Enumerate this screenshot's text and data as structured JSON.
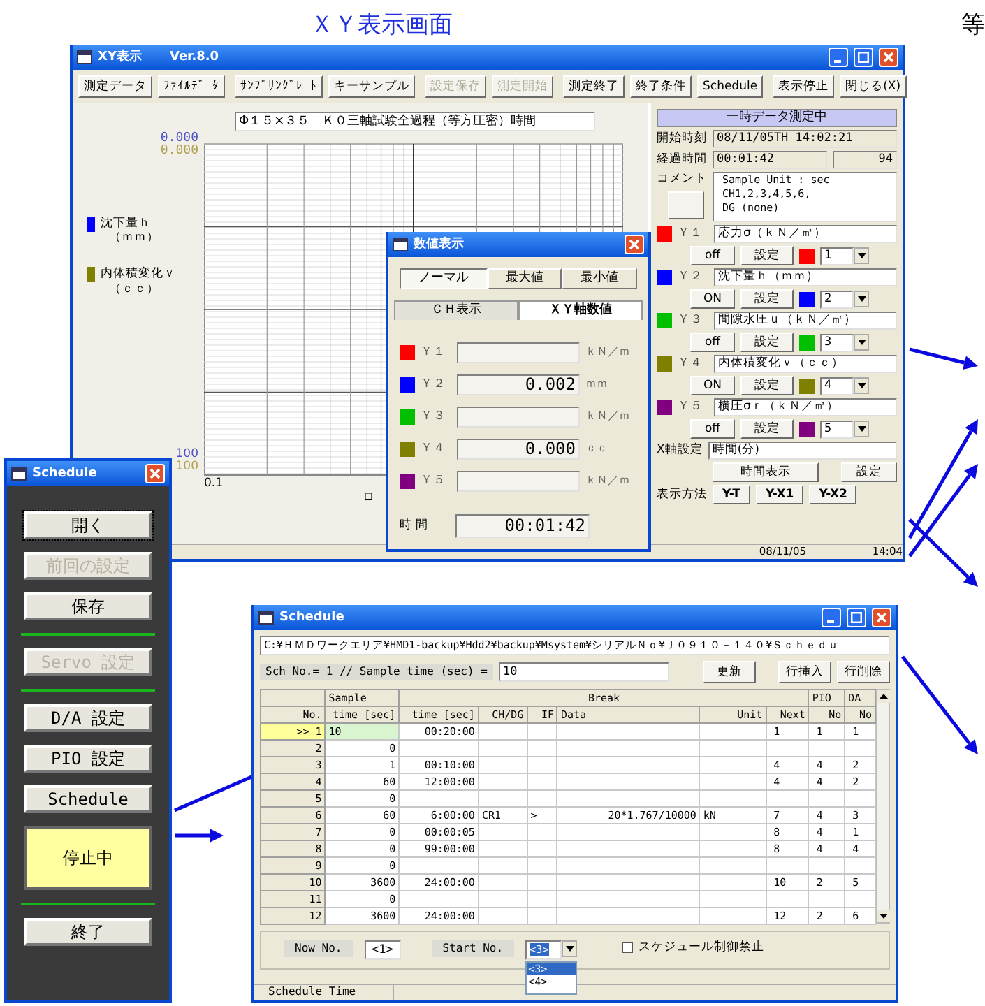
{
  "caption": "ＸＹ表示画面",
  "corner_text": "等",
  "xy_window": {
    "title": "XY表示",
    "version": "Ver.8.0",
    "toolbar": [
      {
        "label": "測定データ",
        "disabled": false
      },
      {
        "label": "ﾌｧｲﾙﾃﾞｰﾀ",
        "disabled": false
      },
      {
        "label": "ｻﾝﾌﾟﾘﾝｸﾞﾚｰﾄ",
        "disabled": false
      },
      {
        "label": "キーサンプル",
        "disabled": false
      },
      {
        "label": "設定保存",
        "disabled": true
      },
      {
        "label": "測定開始",
        "disabled": true
      },
      {
        "label": "測定終了",
        "disabled": false
      },
      {
        "label": "終了条件",
        "disabled": false
      },
      {
        "label": "Schedule",
        "disabled": false
      },
      {
        "label": "表示停止",
        "disabled": false
      },
      {
        "label": "閉じる(X)",
        "disabled": false
      }
    ],
    "chart": {
      "title": "Φ１５×３５　Ｋ０三軸試験全過程（等方圧密）時間",
      "y_top": [
        {
          "text": "0.000",
          "color": "#5050c8"
        },
        {
          "text": "0.000",
          "color": "#b0a050"
        }
      ],
      "y_bottom": [
        {
          "text": "100",
          "color": "#5050c8"
        },
        {
          "text": "100",
          "color": "#b0a050"
        }
      ],
      "x_start": "0.1",
      "x_mark": "ロ",
      "legend": [
        {
          "label": "沈下量ｈ",
          "unit": "（ｍｍ）",
          "color": "#0000ff"
        },
        {
          "label": "内体積変化ｖ",
          "unit": "（ｃｃ）",
          "color": "#808000"
        }
      ]
    },
    "panel": {
      "status": "一時データ測定中",
      "start_label": "開始時刻",
      "start_value": "08/11/05TH 14:02:21",
      "elapsed_label": "経過時間",
      "elapsed_value": "00:01:42",
      "count": "94",
      "comment_label": "コメント",
      "comment_lines": [
        "Sample Unit : sec",
        "CH1,2,3,4,5,6,",
        "DG (none)"
      ],
      "channels": [
        {
          "label": "Ｙ１",
          "name": "応力σ（ｋＮ／㎡）",
          "toggle": "off",
          "set": "設定",
          "color": "#ff0000",
          "number": "1"
        },
        {
          "label": "Ｙ２",
          "name": "沈下量ｈ（ｍｍ）",
          "toggle": "ON",
          "set": "設定",
          "color": "#0000ff",
          "number": "2"
        },
        {
          "label": "Ｙ３",
          "name": "間隙水圧ｕ（ｋＮ／㎡）",
          "toggle": "off",
          "set": "設定",
          "color": "#00c000",
          "number": "3"
        },
        {
          "label": "Ｙ４",
          "name": "内体積変化ｖ（ｃｃ）",
          "toggle": "ON",
          "set": "設定",
          "color": "#808000",
          "number": "4"
        },
        {
          "label": "Ｙ５",
          "name": "横圧σｒ（ｋＮ／㎡）",
          "toggle": "off",
          "set": "設定",
          "color": "#800080",
          "number": "5"
        }
      ],
      "x_axis_label": "X軸設定",
      "x_axis_value": "時間(分)",
      "time_button": "時間表示",
      "set_button": "設定",
      "mode_label": "表示方法",
      "modes": [
        "Y-T",
        "Y-X1",
        "Y-X2"
      ]
    },
    "status_bar": [
      "08/11/05",
      "14:04"
    ]
  },
  "value_window": {
    "title": "数値表示",
    "tabs": [
      {
        "label": "ノーマル",
        "selected": true
      },
      {
        "label": "最大値",
        "selected": false
      },
      {
        "label": "最小値",
        "selected": false
      }
    ],
    "view_tabs": [
      {
        "label": "ＣＨ表示",
        "selected": false
      },
      {
        "label": "ＸＹ軸数値",
        "selected": true
      }
    ],
    "rows": [
      {
        "label": "Ｙ１",
        "color": "#ff0000",
        "unit": "ｋＮ／ｍ"
      },
      {
        "label": "Ｙ２",
        "color": "#0000ff",
        "value": "0.002",
        "unit": "ｍｍ"
      },
      {
        "label": "Ｙ３",
        "color": "#00c000",
        "unit": "ｋＮ／ｍ"
      },
      {
        "label": "Ｙ４",
        "color": "#808000",
        "value": "0.000",
        "unit": "ｃｃ"
      },
      {
        "label": "Ｙ５",
        "color": "#800080",
        "unit": "ｋＮ／ｍ"
      }
    ],
    "time_label": "時 間",
    "time_value": "00:01:42"
  },
  "schedule_panel": {
    "title": "Schedule",
    "items": [
      {
        "kind": "button",
        "label": "開く",
        "disabled": false
      },
      {
        "kind": "button",
        "label": "前回の設定",
        "disabled": true
      },
      {
        "kind": "button",
        "label": "保存",
        "disabled": false
      },
      {
        "kind": "divider"
      },
      {
        "kind": "button",
        "label": "Servo 設定",
        "disabled": true
      },
      {
        "kind": "divider"
      },
      {
        "kind": "button",
        "label": "D/A 設定",
        "disabled": false
      },
      {
        "kind": "button",
        "label": "PIO 設定",
        "disabled": false
      },
      {
        "kind": "button",
        "label": "Schedule",
        "disabled": false
      },
      {
        "kind": "status",
        "label": "停止中"
      },
      {
        "kind": "divider"
      },
      {
        "kind": "button",
        "label": "終了",
        "disabled": false
      }
    ]
  },
  "schedule_window": {
    "title": "Schedule",
    "path": "C:¥ＨＭＤワークエリア¥HMD1-backup¥Hdd2¥backup¥Msystem¥シリアルＮｏ¥Ｊ０９１０－１４０¥Ｓｃｈｅｄｕ",
    "sch_label": "Sch No.= 1 // Sample time (sec) =",
    "sch_value": "10",
    "buttons": [
      "更新",
      "行挿入",
      "行削除"
    ],
    "row_header": "No.",
    "column_groups": [
      {
        "label": "Sample",
        "columns": [
          "time [sec]"
        ]
      },
      {
        "label": "Break",
        "columns": [
          "time [sec]",
          "CH/DG",
          "IF",
          "Data",
          "Unit",
          "Next"
        ]
      },
      {
        "label": "PIO",
        "columns": [
          "No"
        ]
      },
      {
        "label": "DA",
        "columns": [
          "No"
        ]
      }
    ],
    "rows": [
      {
        "no": ">> 1",
        "selected": true,
        "cells": [
          "10",
          "00:20:00",
          null,
          null,
          null,
          null,
          "1",
          "1",
          "1"
        ]
      },
      {
        "no": "2",
        "selected": false,
        "cells": [
          "0",
          null,
          null,
          null,
          null,
          null,
          null,
          null,
          null
        ]
      },
      {
        "no": "3",
        "selected": false,
        "cells": [
          "1",
          "00:10:00",
          null,
          null,
          null,
          null,
          "4",
          "4",
          "2"
        ]
      },
      {
        "no": "4",
        "selected": false,
        "cells": [
          "60",
          "12:00:00",
          null,
          null,
          null,
          null,
          "4",
          "4",
          "2"
        ]
      },
      {
        "no": "5",
        "selected": false,
        "cells": [
          "0",
          null,
          null,
          null,
          null,
          null,
          null,
          null,
          null
        ]
      },
      {
        "no": "6",
        "selected": false,
        "cells": [
          "60",
          "6:00:00",
          "CR1",
          ">",
          "20*1.767/10000",
          "kN",
          "7",
          "4",
          "3"
        ]
      },
      {
        "no": "7",
        "selected": false,
        "cells": [
          "0",
          "00:00:05",
          null,
          null,
          null,
          null,
          "8",
          "4",
          "1"
        ]
      },
      {
        "no": "8",
        "selected": false,
        "cells": [
          "0",
          "99:00:00",
          null,
          null,
          null,
          null,
          "8",
          "4",
          "4"
        ]
      },
      {
        "no": "9",
        "selected": false,
        "cells": [
          "0",
          null,
          null,
          null,
          null,
          null,
          null,
          null,
          null
        ]
      },
      {
        "no": "10",
        "selected": false,
        "cells": [
          "3600",
          "24:00:00",
          null,
          null,
          null,
          null,
          "10",
          "2",
          "5"
        ]
      },
      {
        "no": "11",
        "selected": false,
        "cells": [
          "0",
          null,
          null,
          null,
          null,
          null,
          null,
          null,
          null
        ]
      },
      {
        "no": "12",
        "selected": false,
        "cells": [
          "3600",
          "24:00:00",
          null,
          null,
          null,
          null,
          "12",
          "2",
          "6"
        ]
      }
    ],
    "now_label": "Now No.",
    "now_value": "<1>",
    "start_label": "Start No.",
    "start_value": "<3>",
    "start_options": [
      {
        "label": "<3>",
        "selected": true
      },
      {
        "label": "<4>",
        "selected": false
      }
    ],
    "checkbox": {
      "label": "スケジュール制御禁止",
      "checked": false
    },
    "status": "Schedule Time"
  }
}
